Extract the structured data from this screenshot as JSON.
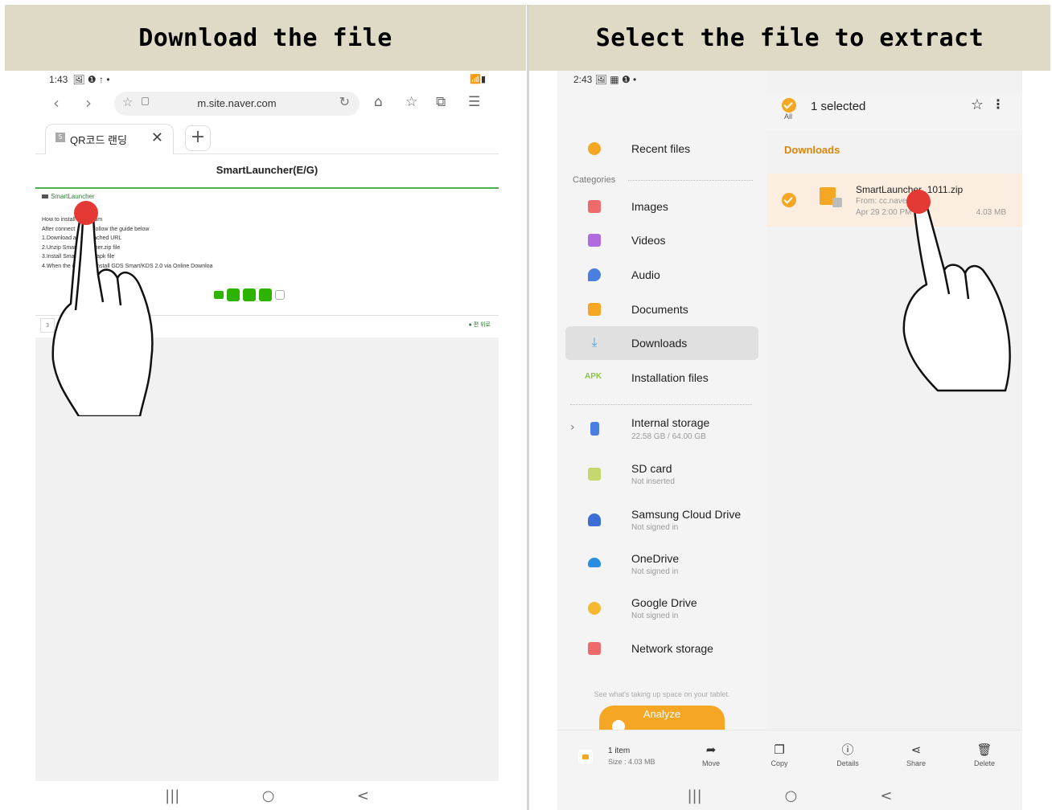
{
  "banners": {
    "left": "Download the file",
    "right": "Select the file to extract"
  },
  "browser": {
    "status_time": "1:43",
    "status_icons": "🖼 ❶ ↑ •",
    "status_right": "📶▮",
    "url": "m.site.naver.com",
    "tab_title": "QR코드 랜딩",
    "tab_favicon": "S",
    "page_title": "SmartLauncher(E/G)",
    "brand": "SmartLauncher",
    "instructions": "How to install         gram\nAfter connect          , follow the guide below\n1.Download a          tached URL\n2.Unzip Smart           her.zip file\n3.Install Smart          r.apk file\n4.When the in            install GDS Smart/KDS 2.0 via Online Downloa",
    "footer_right": "● 편 위로",
    "footer_box": "3",
    "nav": {
      "recents": "|||",
      "home": "○",
      "back": "<"
    }
  },
  "files": {
    "status_time": "2:43",
    "status_icons": "🖼 ▦ ❶ •",
    "status_right": "📶▮",
    "selected_text": "1 selected",
    "all_label": "All",
    "sidebar": {
      "recent": "Recent files",
      "categories_label": "Categories",
      "images": "Images",
      "videos": "Videos",
      "audio": "Audio",
      "documents": "Documents",
      "downloads": "Downloads",
      "installation": "Installation files",
      "apk_badge": "APK",
      "internal": "Internal storage",
      "internal_sub": "22.58 GB / 64.00 GB",
      "sd": "SD card",
      "sd_sub": "Not inserted",
      "samsung": "Samsung Cloud Drive",
      "samsung_sub": "Not signed in",
      "onedrive": "OneDrive",
      "onedrive_sub": "Not signed in",
      "gdrive": "Google Drive",
      "gdrive_sub": "Not signed in",
      "network": "Network storage",
      "hint": "See what's taking up space on your tablet.",
      "analyze": "Analyze"
    },
    "section_title": "Downloads",
    "file": {
      "name": "SmartLauncher_1011.zip",
      "from": "From: cc.nave",
      "date": "Apr 29 2:00 PM",
      "size": "4.03 MB"
    },
    "bottom": {
      "count": "1 item",
      "size": "Size : 4.03 MB",
      "move": "Move",
      "copy": "Copy",
      "details": "Details",
      "share": "Share",
      "delete": "Delete"
    },
    "nav": {
      "recents": "|||",
      "home": "○",
      "back": "<"
    }
  },
  "colors": {
    "banner": "#dfdac5",
    "accent": "#f5a623",
    "selected_row": "#fbeee0",
    "tap": "#e53935",
    "browser_green": "#4caf50"
  }
}
